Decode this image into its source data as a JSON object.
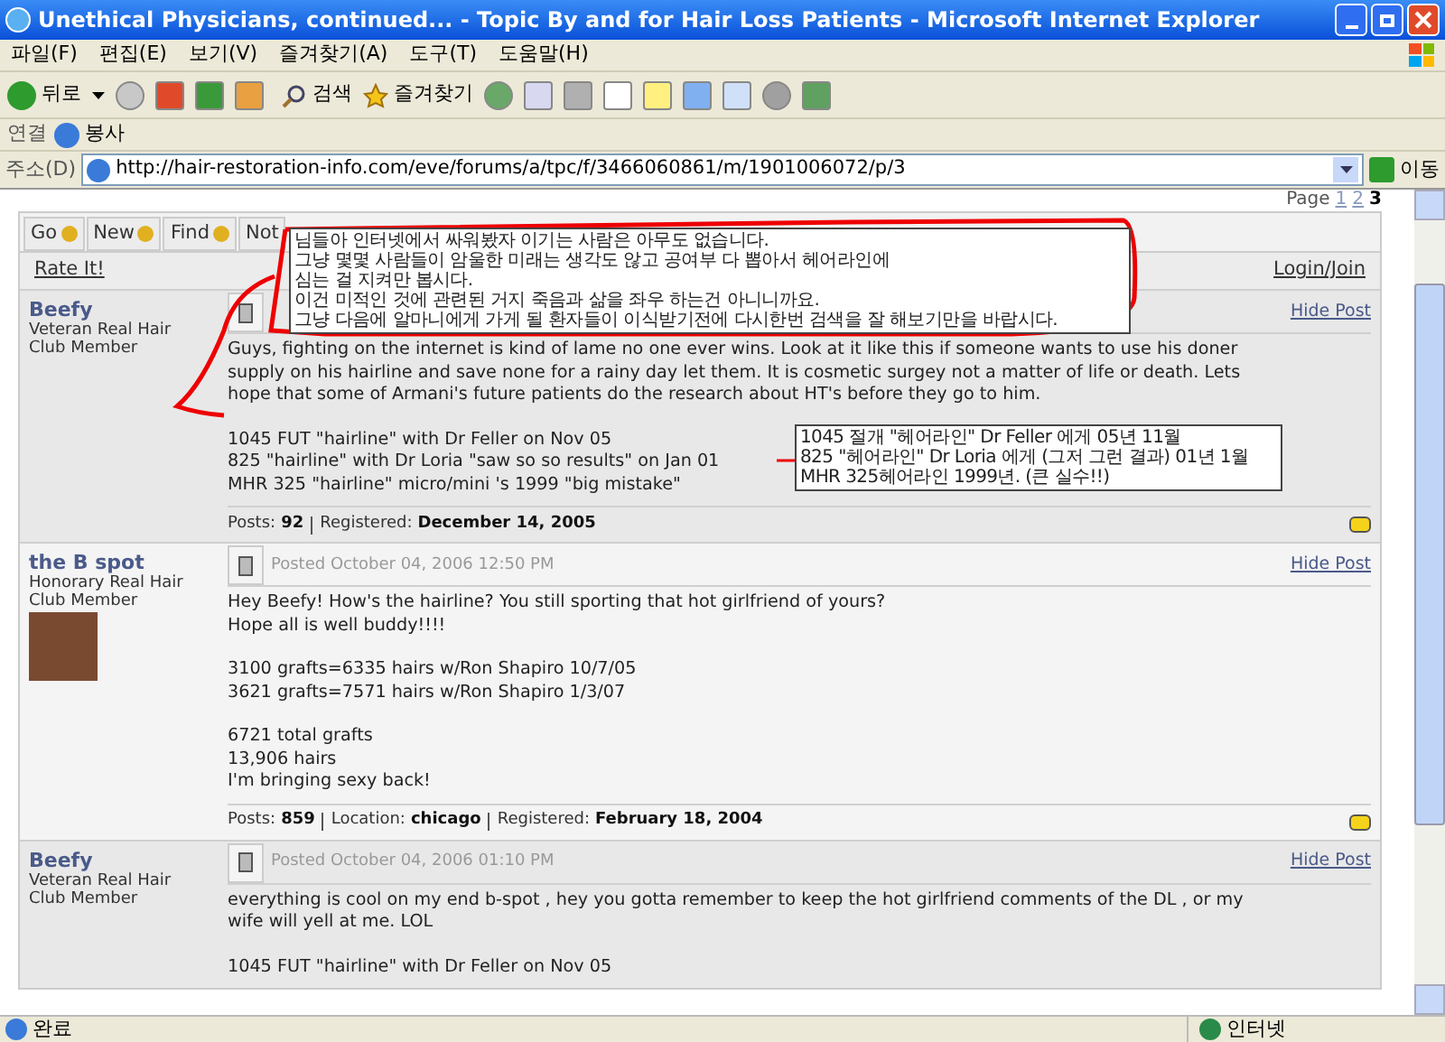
{
  "window": {
    "title": "Unethical Physicians, continued... - Topic By and for Hair Loss Patients - Microsoft Internet Explorer"
  },
  "menu_bar": [
    "파일(F)",
    "편집(E)",
    "보기(V)",
    "즐겨찾기(A)",
    "도구(T)",
    "도움말(H)"
  ],
  "toolbar": {
    "back": "뒤로",
    "search": "검색",
    "favorites": "즐겨찾기"
  },
  "links_bar": {
    "label": "연결",
    "items": [
      "봉사"
    ]
  },
  "address_bar": {
    "label": "주소(D)",
    "url": "http://hair-restoration-info.com/eve/forums/a/tpc/f/3466060861/m/1901006072/p/3",
    "go": "이동"
  },
  "pagination": {
    "label": "Page",
    "pages": [
      {
        "label": "1",
        "selected": false
      },
      {
        "label": "2",
        "selected": false
      },
      {
        "label": "3",
        "selected": true
      }
    ]
  },
  "forum_tabs": [
    "Go",
    "New",
    "Find",
    "Not"
  ],
  "rate_link": "Rate It!",
  "login_link": "Login/Join",
  "posts": [
    {
      "author": "Beefy",
      "rank": "Veteran Real Hair Club Member",
      "avatar": false,
      "hide": "Hide Post",
      "body": [
        [
          "Guys, fighting on the internet is kind of lame no one ever wins. Look at it like this if someone wants to use his doner",
          "supply on his hairline and save none for a rainy day let them. It is cosmetic surgey not a matter of life or death. Lets",
          "hope that some of Armani's future patients do the research about HT's before they go to him."
        ],
        [
          "1045 FUT \"hairline\" with Dr Feller on Nov 05",
          "825 \"hairline\" with Dr Loria \"saw so so results\" on Jan 01",
          "MHR 325 \"hairline\" micro/mini 's 1999 \"big mistake\""
        ]
      ],
      "stats": [
        {
          "label": "Posts:",
          "value": "92"
        },
        {
          "label": "Registered:",
          "value": "December 14, 2005"
        }
      ]
    },
    {
      "author": "the B spot",
      "rank": "Honorary Real Hair Club Member",
      "avatar": true,
      "posted": "Posted October 04, 2006 12:50 PM",
      "hide": "Hide Post",
      "body": [
        [
          "Hey Beefy! How's the hairline? You still sporting that hot girlfriend of yours?",
          "Hope all is well buddy!!!!"
        ],
        [
          "3100 grafts=6335 hairs w/Ron Shapiro 10/7/05",
          "3621 grafts=7571 hairs w/Ron Shapiro 1/3/07"
        ],
        [
          "6721 total grafts",
          "13,906 hairs",
          "I'm bringing sexy back!"
        ]
      ],
      "stats": [
        {
          "label": "Posts:",
          "value": "859"
        },
        {
          "label": "Location:",
          "value": "chicago"
        },
        {
          "label": "Registered:",
          "value": "February 18, 2004"
        }
      ]
    },
    {
      "author": "Beefy",
      "rank": "Veteran Real Hair Club Member",
      "avatar": false,
      "posted": "Posted October 04, 2006 01:10 PM",
      "hide": "Hide Post",
      "body": [
        [
          "everything is cool on my end b-spot , hey you gotta remember to keep the hot girlfriend comments of the DL , or my",
          "wife will yell at me. LOL"
        ],
        [
          "1045 FUT \"hairline\" with Dr Feller on Nov 05"
        ]
      ]
    }
  ],
  "annotations": [
    {
      "lines": [
        "님들아 인터넷에서 싸워봤자 이기는 사람은 아무도 없습니다.",
        "그냥 몇몇 사람들이 암울한 미래는 생각도 않고 공여부 다 뽑아서 헤어라인에",
        "심는 걸 지켜만 봅시다.",
        "이건 미적인 것에 관련된 거지 죽음과 삶을 좌우 하는건 아니니까요.",
        "그냥 다음에 알마니에게 가게 될 환자들이 이식받기전에 다시한번 검색을 잘 해보기만을  바랍시다."
      ]
    },
    {
      "lines": [
        "1045 절개 \"헤어라인\" Dr Feller 에게 05년 11월",
        "825 \"헤어라인\" Dr Loria 에게 (그저 그런 결과) 01년 1월",
        "MHR 325헤어라인 1999년. (큰 실수!!)"
      ]
    }
  ],
  "status_bar": {
    "text": "완료",
    "zone": "인터넷"
  }
}
